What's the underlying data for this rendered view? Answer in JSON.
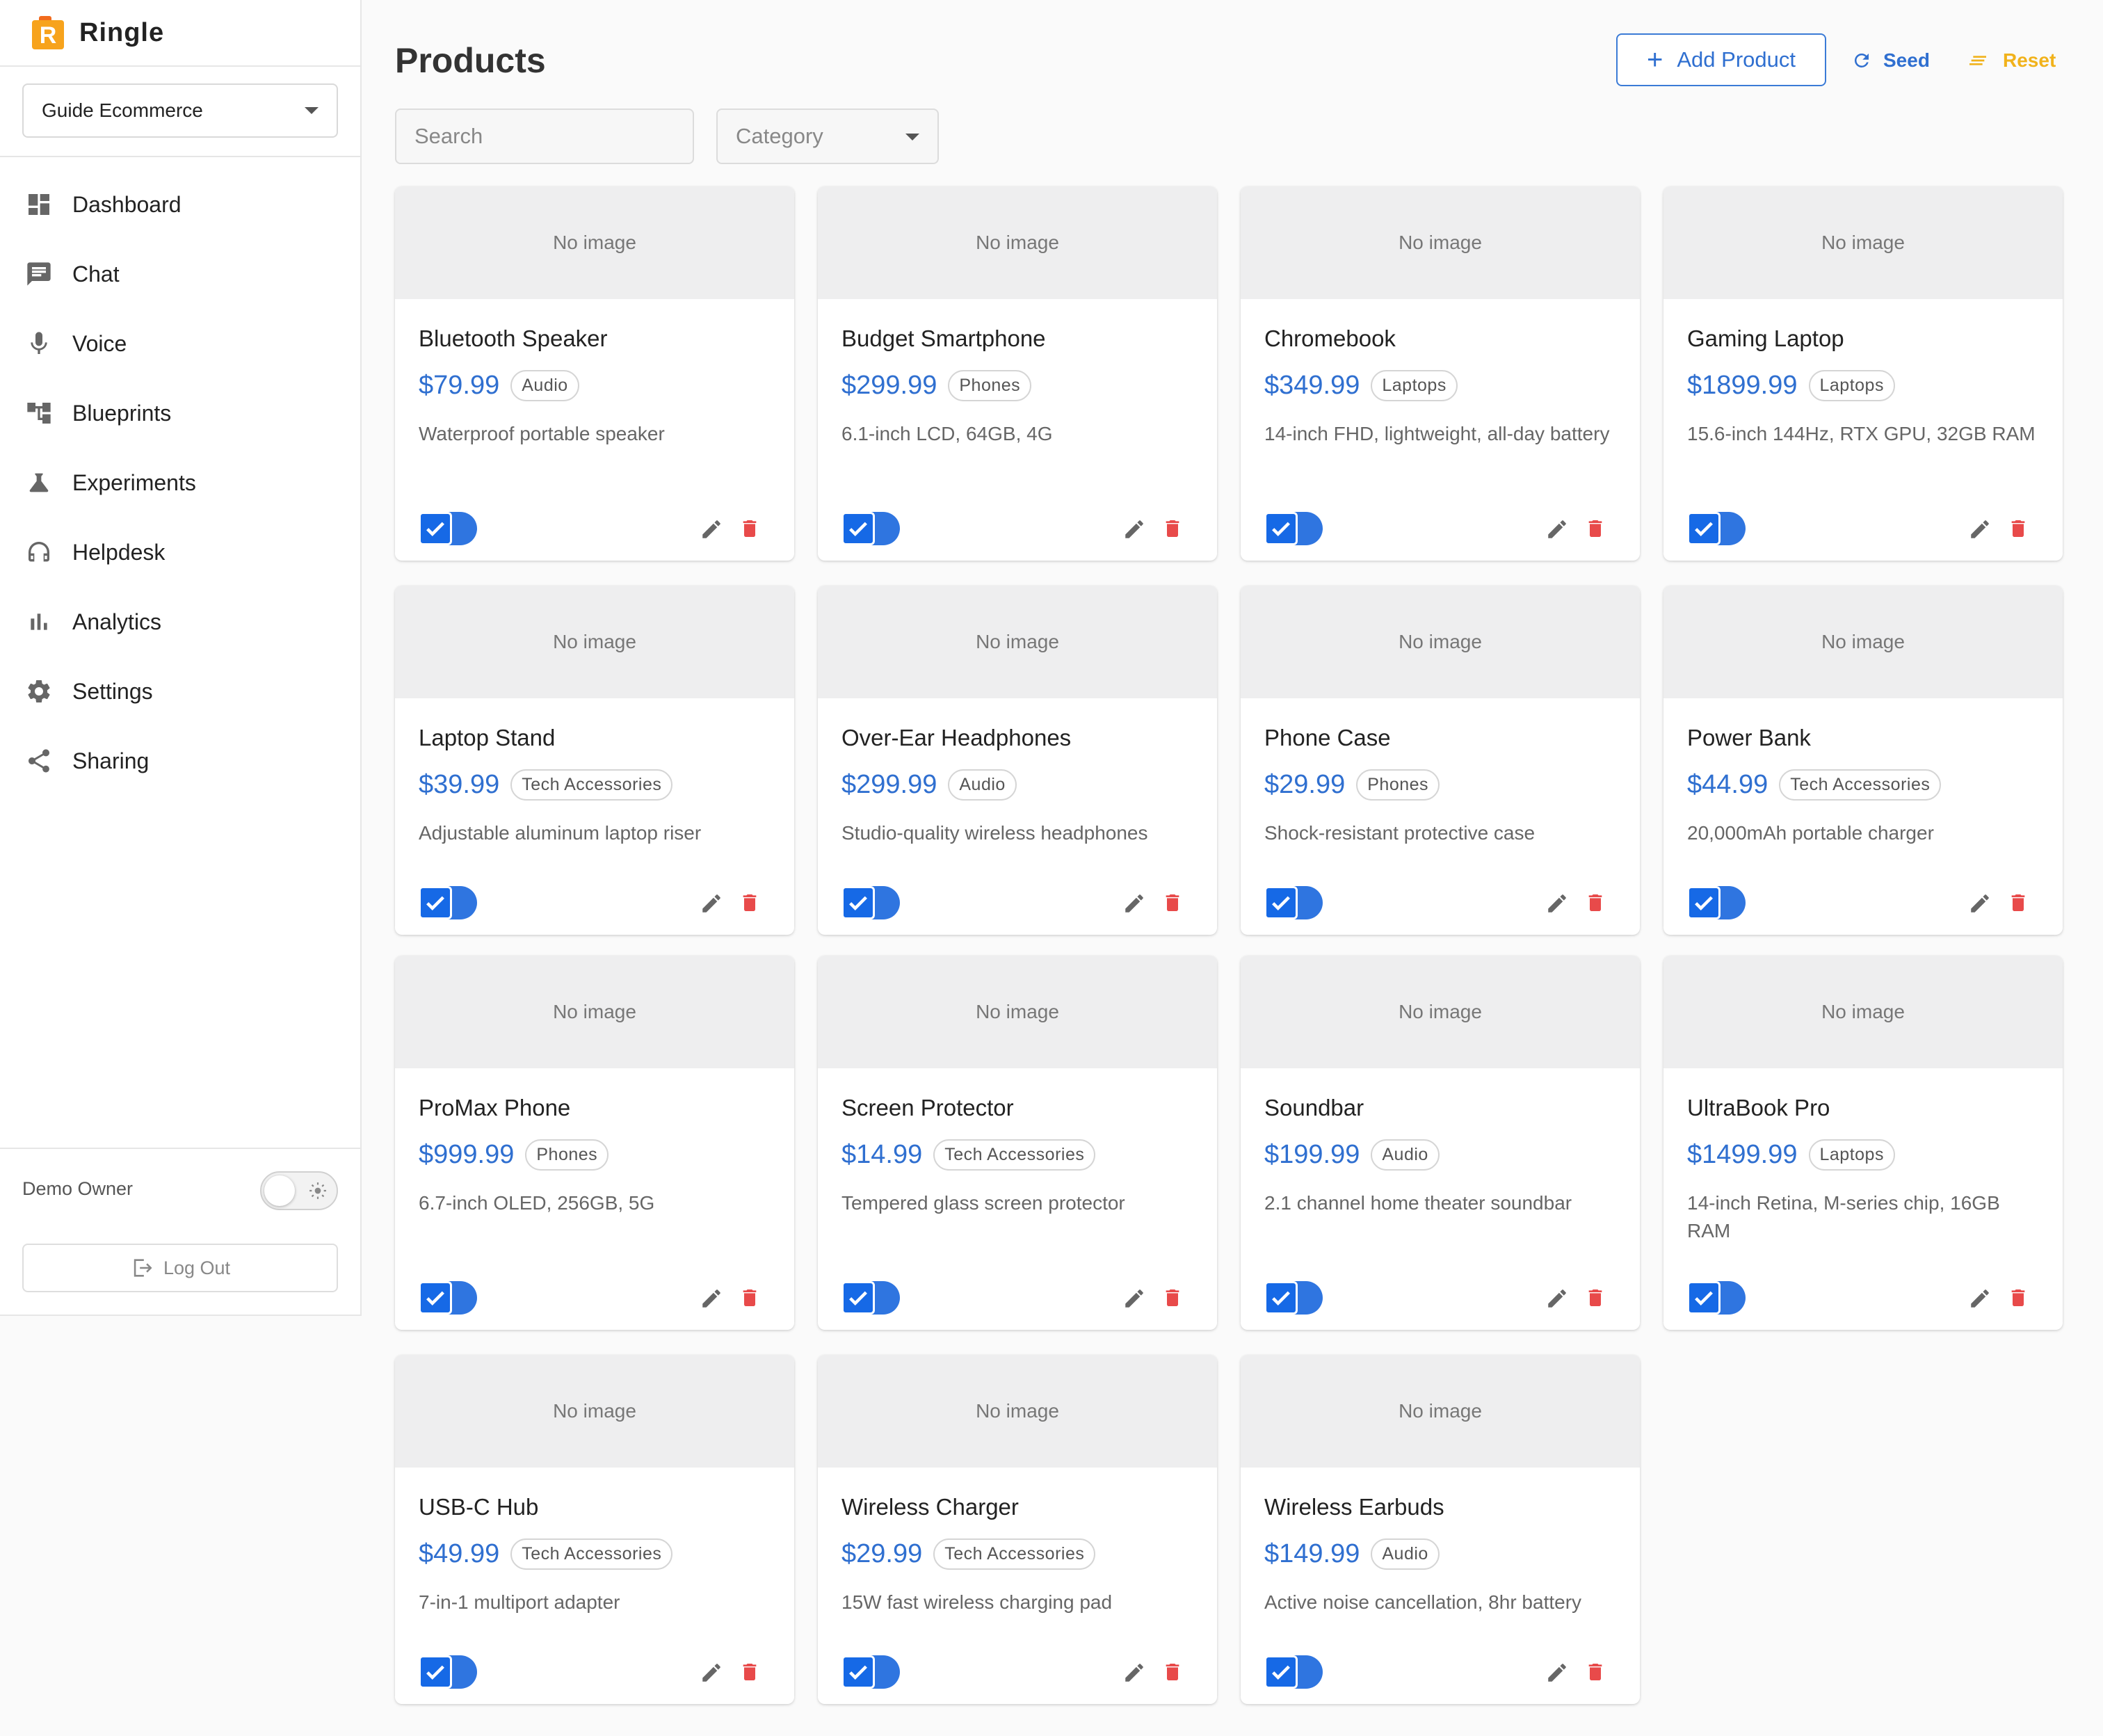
{
  "app": {
    "name": "Ringle",
    "logo_letter": "R"
  },
  "sidebar": {
    "workspace": "Guide Ecommerce",
    "items": [
      {
        "label": "Dashboard",
        "icon": "dashboard-icon"
      },
      {
        "label": "Chat",
        "icon": "chat-icon"
      },
      {
        "label": "Voice",
        "icon": "mic-icon"
      },
      {
        "label": "Blueprints",
        "icon": "blueprint-icon"
      },
      {
        "label": "Experiments",
        "icon": "flask-icon"
      },
      {
        "label": "Helpdesk",
        "icon": "headset-icon"
      },
      {
        "label": "Analytics",
        "icon": "bar-chart-icon"
      },
      {
        "label": "Settings",
        "icon": "gear-icon"
      },
      {
        "label": "Sharing",
        "icon": "share-icon"
      }
    ],
    "owner": "Demo Owner",
    "logout_label": "Log Out"
  },
  "header": {
    "title": "Products",
    "add_label": "Add Product",
    "seed_label": "Seed",
    "reset_label": "Reset"
  },
  "filters": {
    "search_placeholder": "Search",
    "category_placeholder": "Category"
  },
  "no_image_label": "No image",
  "products": [
    {
      "name": "Bluetooth Speaker",
      "price": "$79.99",
      "category": "Audio",
      "description": "Waterproof portable speaker",
      "enabled": true
    },
    {
      "name": "Budget Smartphone",
      "price": "$299.99",
      "category": "Phones",
      "description": "6.1-inch LCD, 64GB, 4G",
      "enabled": true
    },
    {
      "name": "Chromebook",
      "price": "$349.99",
      "category": "Laptops",
      "description": "14-inch FHD, lightweight, all-day battery",
      "enabled": true
    },
    {
      "name": "Gaming Laptop",
      "price": "$1899.99",
      "category": "Laptops",
      "description": "15.6-inch 144Hz, RTX GPU, 32GB RAM",
      "enabled": true
    },
    {
      "name": "Laptop Stand",
      "price": "$39.99",
      "category": "Tech Accessories",
      "description": "Adjustable aluminum laptop riser",
      "enabled": true
    },
    {
      "name": "Over-Ear Headphones",
      "price": "$299.99",
      "category": "Audio",
      "description": "Studio-quality wireless headphones",
      "enabled": true
    },
    {
      "name": "Phone Case",
      "price": "$29.99",
      "category": "Phones",
      "description": "Shock-resistant protective case",
      "enabled": true
    },
    {
      "name": "Power Bank",
      "price": "$44.99",
      "category": "Tech Accessories",
      "description": "20,000mAh portable charger",
      "enabled": true
    },
    {
      "name": "ProMax Phone",
      "price": "$999.99",
      "category": "Phones",
      "description": "6.7-inch OLED, 256GB, 5G",
      "enabled": true
    },
    {
      "name": "Screen Protector",
      "price": "$14.99",
      "category": "Tech Accessories",
      "description": "Tempered glass screen protector",
      "enabled": true
    },
    {
      "name": "Soundbar",
      "price": "$199.99",
      "category": "Audio",
      "description": "2.1 channel home theater soundbar",
      "enabled": true
    },
    {
      "name": "UltraBook Pro",
      "price": "$1499.99",
      "category": "Laptops",
      "description": "14-inch Retina, M-series chip, 16GB RAM",
      "enabled": true
    },
    {
      "name": "USB-C Hub",
      "price": "$49.99",
      "category": "Tech Accessories",
      "description": "7-in-1 multiport adapter",
      "enabled": true
    },
    {
      "name": "Wireless Charger",
      "price": "$29.99",
      "category": "Tech Accessories",
      "description": "15W fast wireless charging pad",
      "enabled": true
    },
    {
      "name": "Wireless Earbuds",
      "price": "$149.99",
      "category": "Audio",
      "description": "Active noise cancellation, 8hr battery",
      "enabled": true
    }
  ],
  "colors": {
    "accent": "#2f6fd0",
    "delete": "#e84a4a",
    "reset": "#f1b21b",
    "toggle": "#1669e6"
  }
}
